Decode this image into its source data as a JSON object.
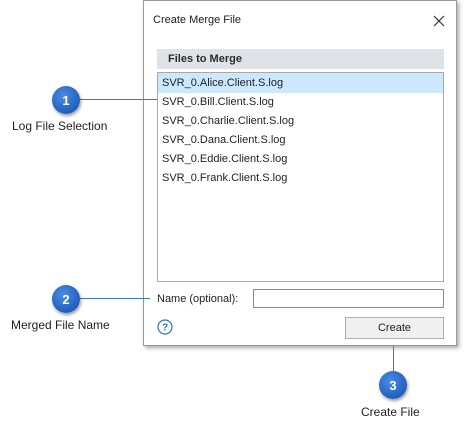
{
  "dialog": {
    "title": "Create Merge File",
    "files_header": "Files to Merge",
    "files": [
      "SVR_0.Alice.Client.S.log",
      "SVR_0.Bill.Client.S.log",
      "SVR_0.Charlie.Client.S.log",
      "SVR_0.Dana.Client.S.log",
      "SVR_0.Eddie.Client.S.log",
      "SVR_0.Frank.Client.S.log"
    ],
    "selected_file": "SVR_0.Alice.Client.S.log",
    "name_label": "Name (optional):",
    "name_value": "",
    "create_label": "Create"
  },
  "callouts": [
    {
      "number": "1",
      "label": "Log File Selection"
    },
    {
      "number": "2",
      "label": "Merged File Name"
    },
    {
      "number": "3",
      "label": "Create File"
    }
  ],
  "colors": {
    "badge": "#1f5fbf",
    "leader_line": "#3a7ab8",
    "selection": "#cce8ff",
    "header_bg": "#dfe3e8",
    "help_icon": "#2f74c0"
  },
  "icons": {
    "close": "close-icon",
    "help": "help-icon"
  }
}
